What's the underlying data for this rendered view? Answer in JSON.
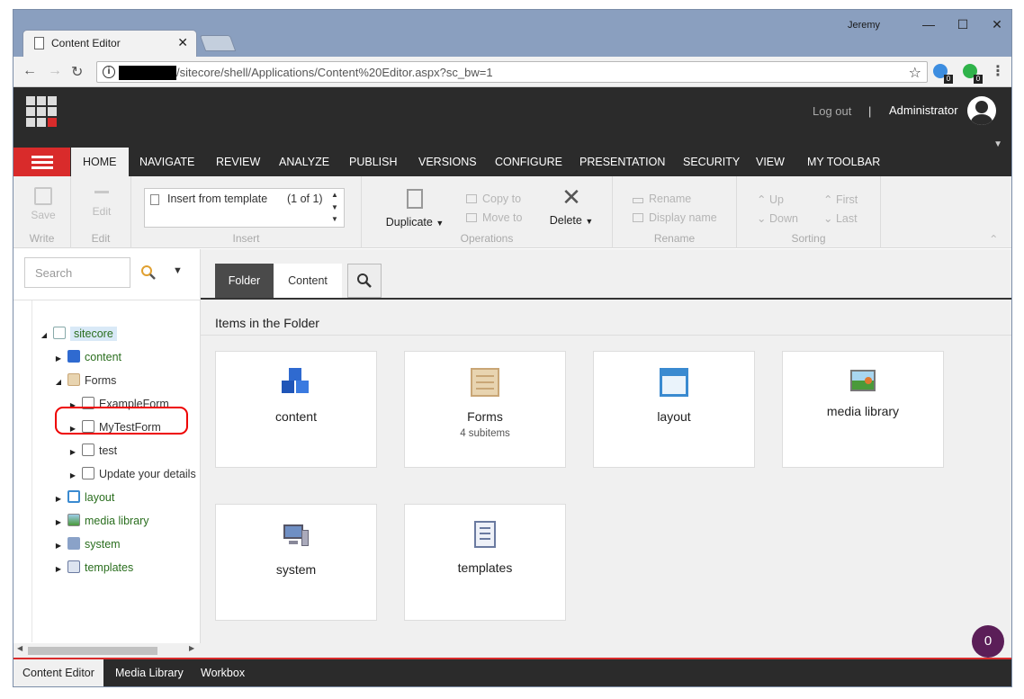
{
  "browser": {
    "tab_title": "Content Editor",
    "close_glyph": "✕",
    "user": "Jeremy",
    "url": "/sitecore/shell/Applications/Content%20Editor.aspx?sc_bw=1",
    "ext_badge_1": "0",
    "ext_badge_2": "0"
  },
  "header": {
    "logout": "Log out",
    "separator": "|",
    "user": "Administrator"
  },
  "ribbon": {
    "tabs": [
      "HOME",
      "NAVIGATE",
      "REVIEW",
      "ANALYZE",
      "PUBLISH",
      "VERSIONS",
      "CONFIGURE",
      "PRESENTATION",
      "SECURITY",
      "VIEW",
      "MY TOOLBAR"
    ],
    "save": "Save",
    "write_label": "Write",
    "edit": "Edit",
    "edit_label": "Edit",
    "insert_item": "Insert from template",
    "insert_count": "(1 of 1)",
    "insert_label": "Insert",
    "duplicate": "Duplicate",
    "copy_to": "Copy to",
    "move_to": "Move to",
    "delete": "Delete",
    "operations_label": "Operations",
    "rename": "Rename",
    "display_name": "Display name",
    "rename_label": "Rename",
    "up": "Up",
    "down": "Down",
    "first": "First",
    "last": "Last",
    "sorting_label": "Sorting"
  },
  "tree": {
    "search_placeholder": "Search",
    "nodes": {
      "sitecore": "sitecore",
      "content": "content",
      "forms": "Forms",
      "exampleform": "ExampleForm",
      "mytestform": "MyTestForm",
      "test": "test",
      "update": "Update your details",
      "layout": "layout",
      "media": "media library",
      "system": "system",
      "templates": "templates"
    }
  },
  "content": {
    "tab_folder": "Folder",
    "tab_content": "Content",
    "heading": "Items in the Folder",
    "tiles": [
      {
        "name": "content",
        "sub": ""
      },
      {
        "name": "Forms",
        "sub": "4 subitems"
      },
      {
        "name": "layout",
        "sub": ""
      },
      {
        "name": "media library",
        "sub": ""
      },
      {
        "name": "system",
        "sub": ""
      },
      {
        "name": "templates",
        "sub": ""
      }
    ],
    "notification_count": "0"
  },
  "bottom": {
    "tabs": [
      "Content Editor",
      "Media Library",
      "Workbox"
    ]
  },
  "colors": {
    "accent_red": "#d92b2b",
    "dark_bar": "#2b2b2b",
    "tree_link_green": "#2a6e1e",
    "badge_purple": "#5b1e58"
  }
}
